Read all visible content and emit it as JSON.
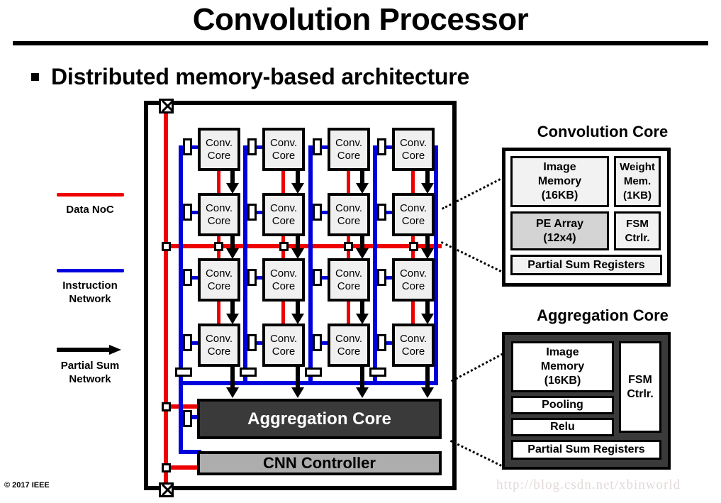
{
  "header": {
    "title": "Convolution Processor",
    "bullet": "Distributed memory-based architecture",
    "bullet_marker": "square-bullet"
  },
  "legend": {
    "items": [
      {
        "label": "Data NoC",
        "kind": "line",
        "color": "#ee0000"
      },
      {
        "label": "Instruction\nNetwork",
        "label_line1": "Instruction",
        "label_line2": "Network",
        "kind": "line",
        "color": "#0000dd"
      },
      {
        "label": "Partial Sum\nNetwork",
        "label_line1": "Partial Sum",
        "label_line2": "Network",
        "kind": "arrow",
        "color": "#000000"
      }
    ]
  },
  "processor": {
    "grid": {
      "rows": 4,
      "cols": 4,
      "cell_label_line1": "Conv.",
      "cell_label_line2": "Core"
    },
    "aggregation_core_label": "Aggregation Core",
    "cnn_controller_label": "CNN Controller"
  },
  "conv_core_detail": {
    "heading": "Convolution Core",
    "image_memory": {
      "line1": "Image",
      "line2": "Memory",
      "line3": "(16KB)"
    },
    "weight_mem": {
      "line1": "Weight",
      "line2": "Mem.",
      "line3": "(1KB)"
    },
    "pe_array": {
      "line1": "PE Array",
      "line2": "(12x4)"
    },
    "fsm": {
      "line1": "FSM",
      "line2": "Ctrlr."
    },
    "partial_sum_registers": "Partial Sum Registers"
  },
  "agg_core_detail": {
    "heading": "Aggregation Core",
    "image_memory": {
      "line1": "Image",
      "line2": "Memory",
      "line3": "(16KB)"
    },
    "pooling": "Pooling",
    "relu": "Relu",
    "fsm": {
      "line1": "FSM",
      "line2": "Ctrlr."
    },
    "partial_sum_registers": "Partial Sum Registers"
  },
  "footer": {
    "copyright": "© 2017 IEEE",
    "watermark": "http://blog.csdn.net/xbinworld"
  },
  "colors": {
    "data_noc": "#ee0000",
    "instruction_network": "#0000dd",
    "partial_sum_network": "#000000",
    "aggregation_core_fill": "#3a3a3a",
    "cnn_controller_fill": "#adadad",
    "conv_core_fill": "#f0f0f0",
    "pe_array_fill": "#d4d4d4"
  }
}
